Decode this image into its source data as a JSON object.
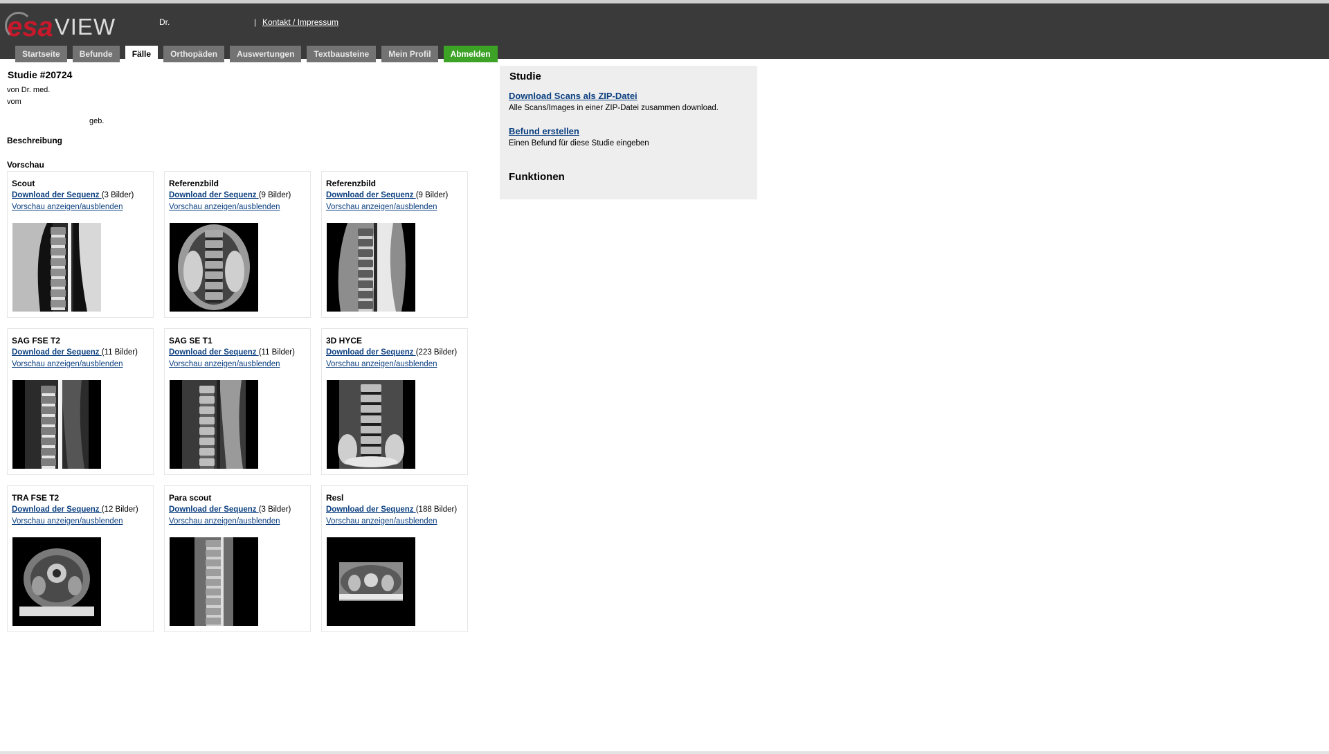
{
  "header": {
    "logo_e": "e",
    "logo_sa": "sa",
    "logo_view": "VIEW",
    "user": "Dr.",
    "separator": "|",
    "contact_link": "Kontakt / Impressum"
  },
  "nav": {
    "tabs": [
      "Startseite",
      "Befunde",
      "Fälle",
      "Orthopäden",
      "Auswertungen",
      "Textbausteine",
      "Mein Profil",
      "Abmelden"
    ],
    "active": "Fälle"
  },
  "study": {
    "title": "Studie #20724",
    "by": "von Dr. med.",
    "date_label": "vom",
    "birth_label": "geb.",
    "description_label": "Beschreibung",
    "preview_label": "Vorschau"
  },
  "sequences": [
    {
      "name": "Scout",
      "download_label": "Download der Sequenz ",
      "count": "(3 Bilder)",
      "toggle_label": "Vorschau anzeigen/ausblenden",
      "kind": "sag-scout"
    },
    {
      "name": "Referenzbild",
      "download_label": "Download der Sequenz ",
      "count": "(9 Bilder)",
      "toggle_label": "Vorschau anzeigen/ausblenden",
      "kind": "coronal"
    },
    {
      "name": "Referenzbild",
      "download_label": "Download der Sequenz ",
      "count": "(9 Bilder)",
      "toggle_label": "Vorschau anzeigen/ausblenden",
      "kind": "sag-bright"
    },
    {
      "name": "SAG FSE T2",
      "download_label": "Download der Sequenz ",
      "count": "(11 Bilder)",
      "toggle_label": "Vorschau anzeigen/ausblenden",
      "kind": "sag-t2"
    },
    {
      "name": "SAG SE T1",
      "download_label": "Download der Sequenz ",
      "count": "(11 Bilder)",
      "toggle_label": "Vorschau anzeigen/ausblenden",
      "kind": "sag-t1"
    },
    {
      "name": "3D HYCE",
      "download_label": "Download der Sequenz ",
      "count": "(223 Bilder)",
      "toggle_label": "Vorschau anzeigen/ausblenden",
      "kind": "coronal-3d"
    },
    {
      "name": "TRA FSE T2",
      "download_label": "Download der Sequenz ",
      "count": "(12 Bilder)",
      "toggle_label": "Vorschau anzeigen/ausblenden",
      "kind": "axial"
    },
    {
      "name": "Para scout",
      "download_label": "Download der Sequenz ",
      "count": "(3 Bilder)",
      "toggle_label": "Vorschau anzeigen/ausblenden",
      "kind": "para"
    },
    {
      "name": "Resl",
      "download_label": "Download der Sequenz ",
      "count": "(188 Bilder)",
      "toggle_label": "Vorschau anzeigen/ausblenden",
      "kind": "resl"
    }
  ],
  "sidebar": {
    "title": "Studie",
    "zip_link": "Download Scans als ZIP-Datei",
    "zip_desc": "Alle Scans/Images in einer ZIP-Datei zusammen download.",
    "befund_link": "Befund erstellen",
    "befund_desc": "Einen Befund für diese Studie eingeben",
    "functions_title": "Funktionen"
  },
  "colors": {
    "header_bg": "#3a3a3a",
    "tab_bg": "#737373",
    "logout_bg": "#3da327",
    "link": "#0b3f80",
    "panel_bg": "#eeeeee",
    "logo_red": "#c8192c"
  }
}
